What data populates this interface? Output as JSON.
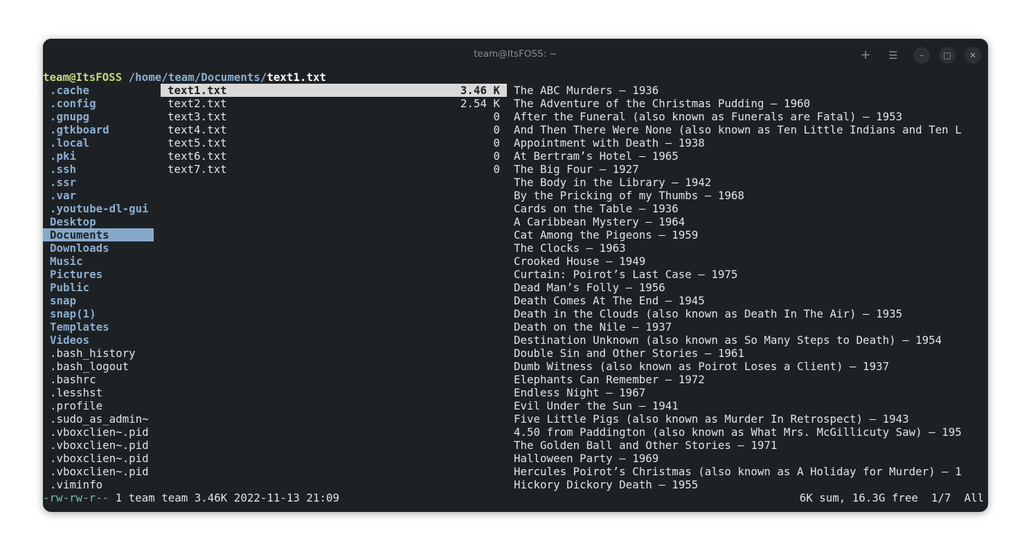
{
  "window": {
    "title": "team@ItsFOSS: ~"
  },
  "header": {
    "user_host": "team@ItsFOSS",
    "path": "/home/team/Documents/",
    "file": "text1.txt"
  },
  "parent_column": {
    "items": [
      {
        "name": ".cache",
        "type": "dir"
      },
      {
        "name": ".config",
        "type": "dir"
      },
      {
        "name": ".gnupg",
        "type": "dir"
      },
      {
        "name": ".gtkboard",
        "type": "dir"
      },
      {
        "name": ".local",
        "type": "dir"
      },
      {
        "name": ".pki",
        "type": "dir"
      },
      {
        "name": ".ssh",
        "type": "dir"
      },
      {
        "name": ".ssr",
        "type": "dir"
      },
      {
        "name": ".var",
        "type": "dir"
      },
      {
        "name": ".youtube-dl-gui",
        "type": "dir"
      },
      {
        "name": "Desktop",
        "type": "dir"
      },
      {
        "name": "Documents",
        "type": "dir",
        "selected": true
      },
      {
        "name": "Downloads",
        "type": "dir"
      },
      {
        "name": "Music",
        "type": "dir"
      },
      {
        "name": "Pictures",
        "type": "dir"
      },
      {
        "name": "Public",
        "type": "dir"
      },
      {
        "name": "snap",
        "type": "dir"
      },
      {
        "name": "snap(1)",
        "type": "dir"
      },
      {
        "name": "Templates",
        "type": "dir"
      },
      {
        "name": "Videos",
        "type": "dir"
      },
      {
        "name": ".bash_history",
        "type": "file"
      },
      {
        "name": ".bash_logout",
        "type": "file"
      },
      {
        "name": ".bashrc",
        "type": "file"
      },
      {
        "name": ".lesshst",
        "type": "file"
      },
      {
        "name": ".profile",
        "type": "file"
      },
      {
        "name": ".sudo_as_admin~",
        "type": "file"
      },
      {
        "name": ".vboxclien~.pid",
        "type": "file"
      },
      {
        "name": ".vboxclien~.pid",
        "type": "file"
      },
      {
        "name": ".vboxclien~.pid",
        "type": "file"
      },
      {
        "name": ".vboxclien~.pid",
        "type": "file"
      },
      {
        "name": ".viminfo",
        "type": "file"
      }
    ]
  },
  "current_column": {
    "items": [
      {
        "name": "text1.txt",
        "size": "3.46 K",
        "selected": true
      },
      {
        "name": "text2.txt",
        "size": "2.54 K"
      },
      {
        "name": "text3.txt",
        "size": "0"
      },
      {
        "name": "text4.txt",
        "size": "0"
      },
      {
        "name": "text5.txt",
        "size": "0"
      },
      {
        "name": "text6.txt",
        "size": "0"
      },
      {
        "name": "text7.txt",
        "size": "0"
      }
    ]
  },
  "preview": {
    "lines": [
      "The ABC Murders – 1936",
      "The Adventure of the Christmas Pudding – 1960",
      "After the Funeral (also known as Funerals are Fatal) – 1953",
      "And Then There Were None (also known as Ten Little Indians and Ten L",
      "Appointment with Death – 1938",
      "At Bertram’s Hotel – 1965",
      "The Big Four – 1927",
      "The Body in the Library – 1942",
      "By the Pricking of my Thumbs – 1968",
      "Cards on the Table – 1936",
      "A Caribbean Mystery – 1964",
      "Cat Among the Pigeons – 1959",
      "The Clocks – 1963",
      "Crooked House – 1949",
      "Curtain: Poirot’s Last Case – 1975",
      "Dead Man’s Folly – 1956",
      "Death Comes At The End – 1945",
      "Death in the Clouds (also known as Death In The Air) – 1935",
      "Death on the Nile – 1937",
      "Destination Unknown (also known as So Many Steps to Death) – 1954",
      "Double Sin and Other Stories – 1961",
      "Dumb Witness (also known as Poirot Loses a Client) – 1937",
      "Elephants Can Remember – 1972",
      "Endless Night – 1967",
      "Evil Under the Sun – 1941",
      "Five Little Pigs (also known as Murder In Retrospect) – 1943",
      "4.50 from Paddington (also known as What Mrs. McGillicuty Saw) – 195",
      "The Golden Ball and Other Stories – 1971",
      "Halloween Party – 1969",
      "Hercules Poirot’s Christmas (also known as A Holiday for Murder) – 1",
      "Hickory Dickory Death – 1955"
    ]
  },
  "status": {
    "permissions": "-rw-rw-r--",
    "details": " 1 team team 3.46K 2022-11-13 21:09",
    "summary": "6K sum, 16.3G free  1/7  All"
  },
  "icons": {
    "new_tab": "plus-icon",
    "menu": "hamburger-icon",
    "minimize": "minimize-icon",
    "maximize": "maximize-icon",
    "close": "close-icon"
  }
}
